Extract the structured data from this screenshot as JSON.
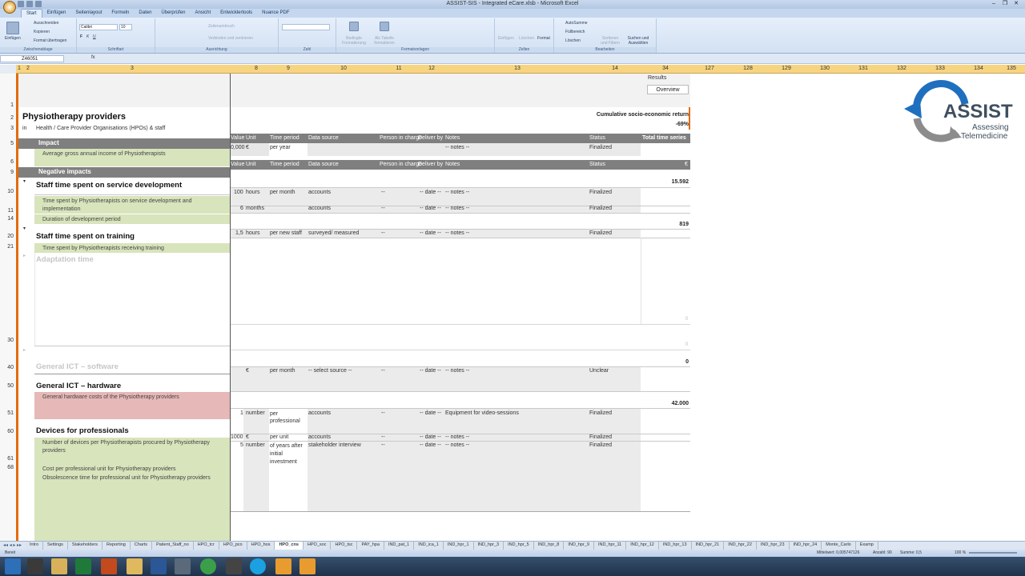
{
  "window": {
    "title": "ASSIST-SIS - Integrated eCare.xlsb - Microsoft Excel",
    "controls": [
      "–",
      "❐",
      "✕"
    ]
  },
  "ribbon_tabs": [
    "Start",
    "Einfügen",
    "Seitenlayout",
    "Formeln",
    "Daten",
    "Überprüfen",
    "Ansicht",
    "Entwicklertools",
    "Nuance PDF"
  ],
  "ribbon": {
    "clipboard": {
      "paste": "Einfügen",
      "cut": "Ausschneiden",
      "copy": "Kopieren",
      "format_painter": "Format übertragen",
      "label": "Zwischenablage"
    },
    "font": {
      "name": "Calibri",
      "size": "10",
      "label": "Schriftart"
    },
    "alignment": {
      "wrap": "Zeilenumbruch",
      "merge": "Verbinden und zentrieren",
      "label": "Ausrichtung"
    },
    "number": {
      "label": "Zahl"
    },
    "styles": {
      "conditional": "Bedingte Formatierung",
      "as_table": "Als Tabelle formatieren",
      "label": "Formatvorlagen"
    },
    "cells": {
      "insert": "Einfügen",
      "delete": "Löschen",
      "format": "Format",
      "label": "Zellen"
    },
    "editing": {
      "autosum": "AutoSumme",
      "fill": "Füllbereich",
      "clear": "Löschen",
      "sort": "Sortieren und Filtern",
      "find": "Suchen und Auswählen",
      "label": "Bearbeiten"
    }
  },
  "formula_bar": {
    "name_box": "Z46051",
    "fx": "fx"
  },
  "columns": [
    "1",
    "2",
    "3",
    "8",
    "9",
    "10",
    "11",
    "12",
    "13",
    "14",
    "34",
    "127",
    "128",
    "129",
    "130",
    "131",
    "132",
    "133",
    "134",
    "135"
  ],
  "rows": [
    "1",
    "2",
    "3",
    "5",
    "6",
    "9",
    "10",
    "11",
    "14",
    "20",
    "21",
    "30",
    "40",
    "50",
    "51",
    "60",
    "61",
    "68"
  ],
  "sheet": {
    "title": "Physiotherapy providers",
    "in_label": "in",
    "subtitle": "Health / Care Provider Organisations (HPOs) & staff",
    "results_label": "Results",
    "overview_button": "Overview",
    "cumulative_label": "Cumulative socio-economic return",
    "cumulative_value": "-69%",
    "header1": {
      "value": "Value",
      "unit": "Unit",
      "time": "Time period",
      "source": "Data source",
      "person": "Person in charge",
      "deliver": "Deliver by",
      "notes": "Notes",
      "status": "Status",
      "total": "Total time series"
    },
    "header2": {
      "value": "Value",
      "unit": "Unit",
      "time": "Time period",
      "source": "Data source",
      "person": "Person in charge",
      "deliver": "Deliver by",
      "notes": "Notes",
      "status": "Status",
      "total": "€"
    },
    "impact": {
      "label": "Impact",
      "item": "Average gross annual income of Physiotherapists",
      "value": "0,000",
      "unit": "€",
      "time": "per year",
      "notes": "-- notes --",
      "status": "Finalized"
    },
    "negative": "Negative impacts",
    "staff_dev": {
      "title": "Staff time spent on service development",
      "total": "15.592",
      "item1": "Time spent by Physiotherapists on service development and implementation",
      "item2": "Duration of development period",
      "r1": {
        "value": "100",
        "unit": "hours",
        "time": "per month",
        "source": "accounts",
        "person": "--",
        "deliver": "-- date --",
        "notes": "-- notes --",
        "status": "Finalized"
      },
      "r2": {
        "value": "6",
        "unit": "months",
        "source": "accounts",
        "person": "--",
        "deliver": "-- date --",
        "notes": "-- notes --",
        "status": "Finalized"
      }
    },
    "staff_train": {
      "title": "Staff time spent on training",
      "total": "819",
      "item": "Time spent by Physiotherapists receiving training",
      "r1": {
        "value": "1,5",
        "unit": "hours",
        "time": "per new staff",
        "source": "surveyed/ measured",
        "person": "--",
        "deliver": "-- date --",
        "notes": "-- notes --",
        "status": "Finalized"
      }
    },
    "adaptation": {
      "title": "Adaptation time",
      "zero1": "0",
      "zero2": "0"
    },
    "software": {
      "title": "General ICT – software",
      "total": "0",
      "r1": {
        "unit": "€",
        "time": "per month",
        "source": "-- select source --",
        "person": "--",
        "deliver": "-- date --",
        "notes": "-- notes --",
        "status": "Unclear"
      }
    },
    "hardware": {
      "title": "General ICT – hardware",
      "total": "42.000",
      "item": "General hardware costs of the Physiotherapy providers"
    },
    "devices": {
      "title": "Devices for professionals",
      "item1": "Number of devices per Physiotherapists procured by Physiotherapy providers",
      "item2": "Cost per professional unit for Physiotherapy providers",
      "item3": "Obsolescence time for professional unit for Physiotherapy providers",
      "r1": {
        "value": "1",
        "unit": "number",
        "time": "per professional",
        "source": "accounts",
        "person": "--",
        "deliver": "-- date --",
        "notes": "Equipment for video-sessions",
        "status": "Finalized"
      },
      "r2": {
        "value": "1000",
        "unit": "€",
        "time": "per unit",
        "source": "accounts",
        "person": "--",
        "deliver": "-- date --",
        "notes": "-- notes --",
        "status": "Finalized"
      },
      "r3": {
        "value": "5",
        "unit": "number",
        "time": "of years after initial investment",
        "source": "stakeholder interview",
        "person": "--",
        "deliver": "-- date --",
        "notes": "-- notes --",
        "status": "Finalized"
      }
    }
  },
  "logo": {
    "name": "ASSIST",
    "line1": "Assessing",
    "line2": "Telemedicine"
  },
  "sheet_tabs": [
    "Intro",
    "Settings",
    "Stakeholders",
    "Reporting",
    "Charts",
    "Patient_Staff_no",
    "HPO_tcr",
    "HPO_pco",
    "HPO_hos",
    "HPO_cns",
    "HPO_soc",
    "HPO_tsc",
    "PAY_hpa",
    "IND_pat_1",
    "IND_ica_1",
    "IND_hpr_1",
    "IND_hpr_3",
    "IND_hpr_5",
    "IND_hpr_8",
    "IND_hpr_9",
    "IND_hpr_11",
    "IND_hpr_12",
    "IND_hpr_13",
    "IND_hpr_21",
    "IND_hpr_22",
    "IND_hpr_23",
    "IND_hpr_24",
    "Monte_Carlo",
    "Examp"
  ],
  "active_sheet": "HPO_cns",
  "status": {
    "ready": "Bereit",
    "average": "Mittelwert: 0,005747126",
    "count": "Anzahl: 90",
    "sum": "Summe: 0,5",
    "zoom": "100 %"
  }
}
